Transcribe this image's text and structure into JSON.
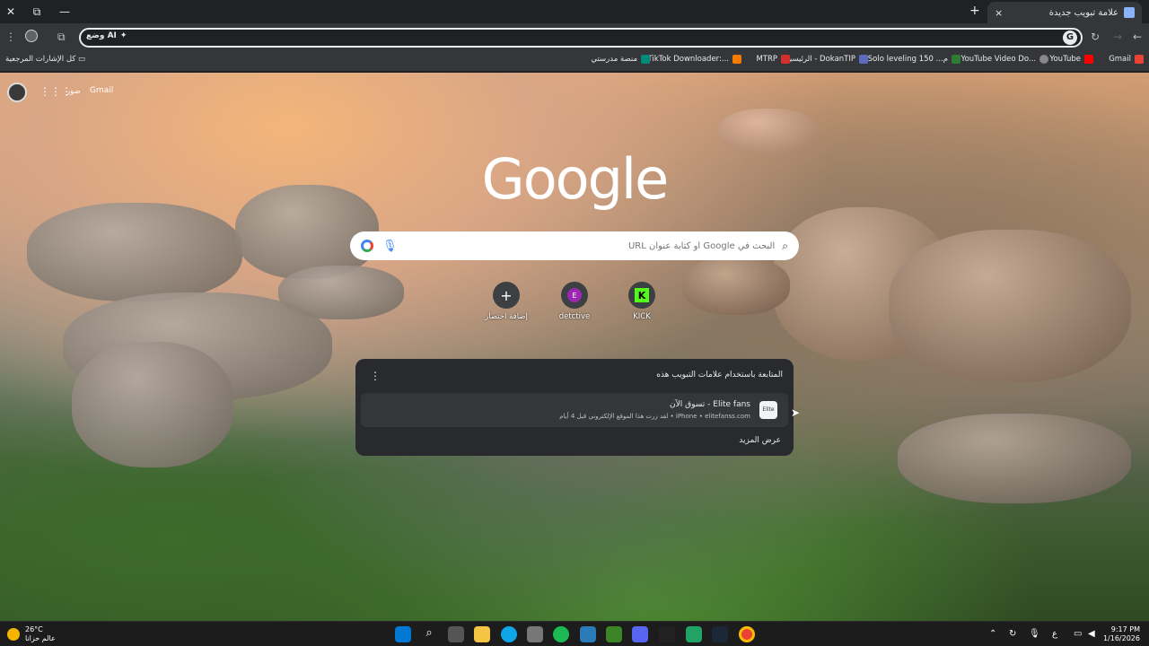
{
  "tab": {
    "title": "علامة تبويب جديدة",
    "close": "×"
  },
  "window": {
    "close": "✕",
    "restore": "⧉",
    "minimize": "—",
    "new_tab": "+"
  },
  "toolbar": {
    "ai_mode": "وضع AI",
    "google_btn": "G",
    "reload": "↻",
    "back": "←",
    "forward": "→",
    "menu": "⋮",
    "extensions": "⧉"
  },
  "bookmarks": {
    "all": "كل الإشارات المرجعية",
    "items": [
      {
        "label": "Gmail",
        "color": "#ea4335"
      },
      {
        "label": "YouTube",
        "color": "#ff0000"
      },
      {
        "label": "YouTube Video Do...",
        "color": "#888888"
      },
      {
        "label": "Solo leveling 150 ...م",
        "color": "#2e7d32"
      },
      {
        "label": "الرئيسية - DokanTIP",
        "color": "#5c6bc0"
      },
      {
        "label": "MTRP",
        "color": "#d32f2f"
      },
      {
        "label": "TikTok Downloader:...",
        "color": "#f57c00"
      },
      {
        "label": "منصة مدرستي",
        "color": "#00897b"
      }
    ]
  },
  "ntp": {
    "gmail": "Gmail",
    "images": "صور",
    "logo": "Google",
    "search_placeholder": "البحث في Google أو كتابة عنوان URL",
    "shortcuts": [
      {
        "label": "إضافة اختصار",
        "glyph": "+",
        "color": "#3c4043"
      },
      {
        "label": "detctive",
        "glyph": "E",
        "color": "#9c27b0"
      },
      {
        "label": "KICK",
        "glyph": "K",
        "color": "#53fc18"
      }
    ]
  },
  "card": {
    "heading": "المتابعة باستخدام علامات التبويب هذه",
    "item_title": "Elite fans - تسوق الآن",
    "item_sub": "iPhone • elitefanss.com • لقد زرت هذا الموقع الإلكتروني قبل 4 أيام",
    "item_icon": "Elite",
    "more": "عرض المزيد"
  },
  "taskbar": {
    "temp": "26°C",
    "weather": "عالم حزانا",
    "time": "9:17 PM",
    "date": "1/16/2026",
    "lang": "ع"
  }
}
